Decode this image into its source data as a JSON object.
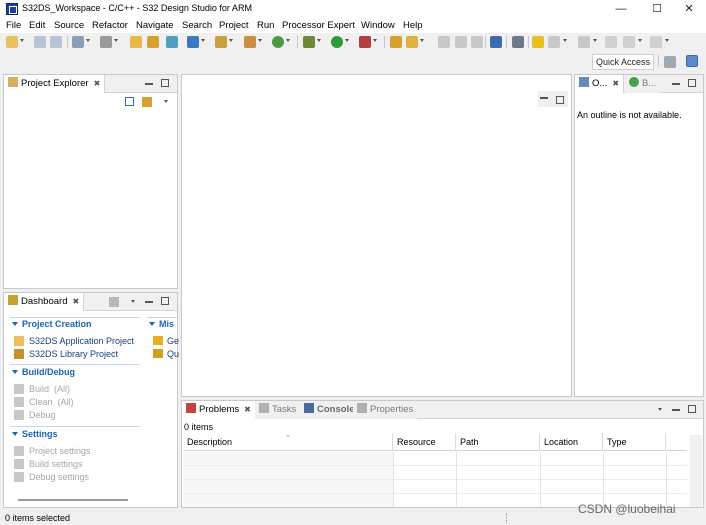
{
  "window": {
    "title": "S32DS_Workspace - C/C++ - S32 Design Studio for ARM"
  },
  "menu": [
    "File",
    "Edit",
    "Source",
    "Refactor",
    "Navigate",
    "Search",
    "Project",
    "Run",
    "Processor Expert",
    "Window",
    "Help"
  ],
  "toolbar": {
    "quick_access_placeholder": "Quick Access"
  },
  "project_explorer": {
    "tab": "Project Explorer"
  },
  "outline": {
    "tab": "O...",
    "tab2": "B...",
    "message": "An outline is not available."
  },
  "dashboard": {
    "tab": "Dashboard",
    "project_creation": {
      "heading": "Project Creation",
      "items": [
        "S32DS Application Project",
        "S32DS Library Project"
      ]
    },
    "misc": {
      "heading": "Mis",
      "items": [
        "Ge",
        "Qu"
      ]
    },
    "build_debug": {
      "heading": "Build/Debug",
      "items": [
        "Build  (All)",
        "Clean  (All)",
        "Debug"
      ]
    },
    "settings": {
      "heading": "Settings",
      "items": [
        "Project settings",
        "Build settings",
        "Debug settings"
      ]
    }
  },
  "bottom": {
    "tabs": [
      "Problems",
      "Tasks",
      "Console",
      "Properties"
    ],
    "count": "0 items",
    "columns": [
      "Description",
      "Resource",
      "Path",
      "Location",
      "Type"
    ]
  },
  "status": {
    "text": "0 items selected"
  },
  "watermark": "CSDN @luobeihai",
  "colors": {
    "accent": "#1a62b6",
    "link": "#1a3f7a",
    "disabled": "#a6a6a6"
  }
}
